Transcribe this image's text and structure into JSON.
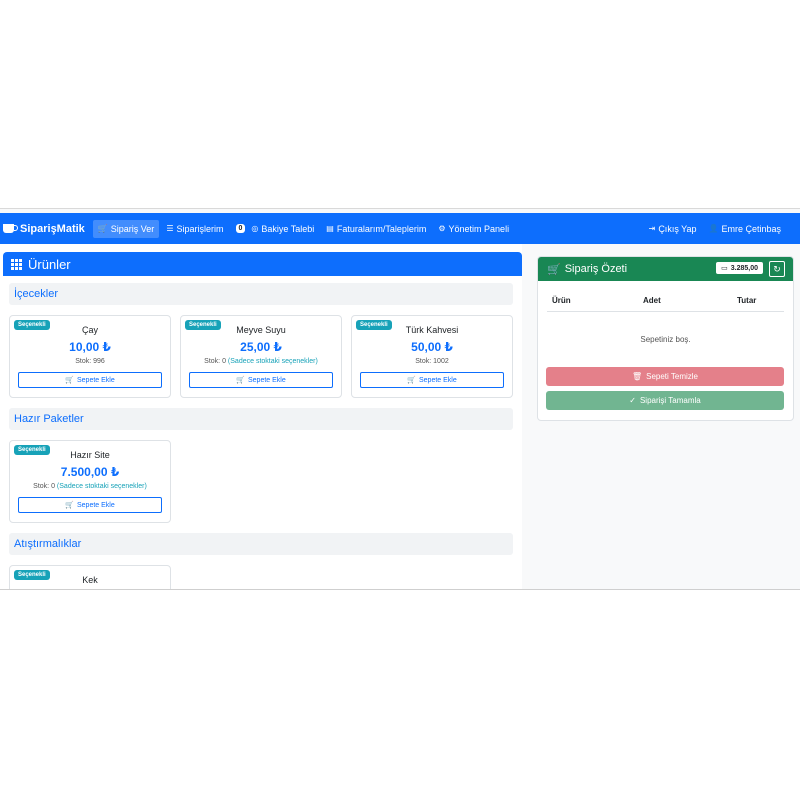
{
  "navbar": {
    "brand": "SiparişMatik",
    "items": [
      {
        "label": "Sipariş Ver",
        "icon": "cart-icon",
        "active": true
      },
      {
        "label": "Siparişlerim",
        "icon": "list-icon"
      },
      {
        "label": "Bakiye Talebi",
        "icon": "coin-icon",
        "badge": "0"
      },
      {
        "label": "Faturalarım/Taleplerim",
        "icon": "invoice-icon"
      },
      {
        "label": "Yönetim Paneli",
        "icon": "gear-icon"
      }
    ],
    "logout": "Çıkış Yap",
    "user": "Emre Çetinbaş",
    "color": "#0d6efd"
  },
  "products": {
    "title": "Ürünler",
    "sections": [
      {
        "title": "İçecekler",
        "cards": [
          {
            "tag": "Seçenekli",
            "name": "Çay",
            "price": "10,00 ₺",
            "stock": "Stok: 996",
            "note": "",
            "button": "Sepete Ekle"
          },
          {
            "tag": "Seçenekli",
            "name": "Meyve Suyu",
            "price": "25,00 ₺",
            "stock": "Stok: 0",
            "note": "(Sadece stoktaki seçenekler)",
            "button": "Sepete Ekle"
          },
          {
            "tag": "Seçenekli",
            "name": "Türk Kahvesi",
            "price": "50,00 ₺",
            "stock": "Stok: 1002",
            "note": "",
            "button": "Sepete Ekle"
          }
        ]
      },
      {
        "title": "Hazır Paketler",
        "cards": [
          {
            "tag": "Seçenekli",
            "name": "Hazır Site",
            "price": "7.500,00 ₺",
            "stock": "Stok: 0",
            "note": "(Sadece stoktaki seçenekler)",
            "button": "Sepete Ekle"
          }
        ]
      },
      {
        "title": "Atıştırmalıklar",
        "cards": [
          {
            "tag": "Seçenekli",
            "name": "Kek"
          }
        ]
      }
    ]
  },
  "summary": {
    "title": "Sipariş Özeti",
    "balance": "3.285,00",
    "columns": [
      "Ürün",
      "Adet",
      "Tutar"
    ],
    "empty": "Sepetiniz boş.",
    "clear_button": "Sepeti Temizle",
    "complete_button": "Siparişi Tamamla",
    "colors": {
      "header": "#198754",
      "clear": "#e4808a",
      "complete": "#71b591"
    }
  }
}
